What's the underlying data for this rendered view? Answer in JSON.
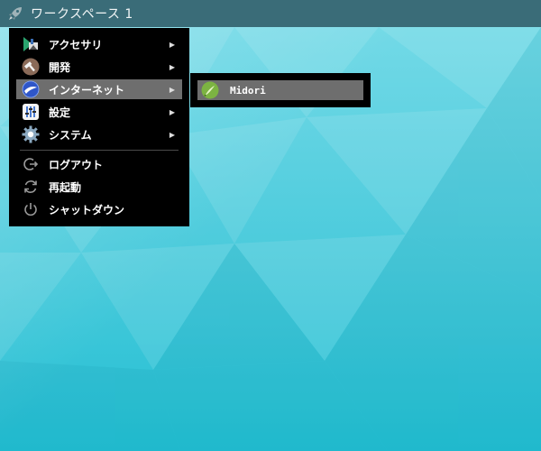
{
  "panel": {
    "workspace_label": "ワークスペース 1",
    "launcher_icon": "rocket-icon",
    "color": "#3a6c78"
  },
  "main_menu": {
    "items": [
      {
        "label": "アクセサリ",
        "icon": "accessories-icon",
        "has_submenu": true
      },
      {
        "label": "開発",
        "icon": "hammer-icon",
        "has_submenu": true
      },
      {
        "label": "インターネット",
        "icon": "internet-globe-icon",
        "has_submenu": true,
        "active": true
      },
      {
        "label": "設定",
        "icon": "settings-icon",
        "has_submenu": true
      },
      {
        "label": "システム",
        "icon": "system-gear-icon",
        "has_submenu": true
      }
    ],
    "actions": [
      {
        "label": "ログアウト",
        "icon": "logout-icon"
      },
      {
        "label": "再起動",
        "icon": "reboot-icon"
      },
      {
        "label": "シャットダウン",
        "icon": "power-icon"
      }
    ],
    "arrow_glyph": "▶",
    "highlight_color": "#6e6e6e"
  },
  "sub_menu": {
    "items": [
      {
        "label": "Midori",
        "icon": "midori-browser-icon",
        "active": true
      }
    ]
  },
  "desktop": {
    "background_colors": [
      "#77dbe8",
      "#4ccbdc",
      "#23bfd3"
    ]
  }
}
